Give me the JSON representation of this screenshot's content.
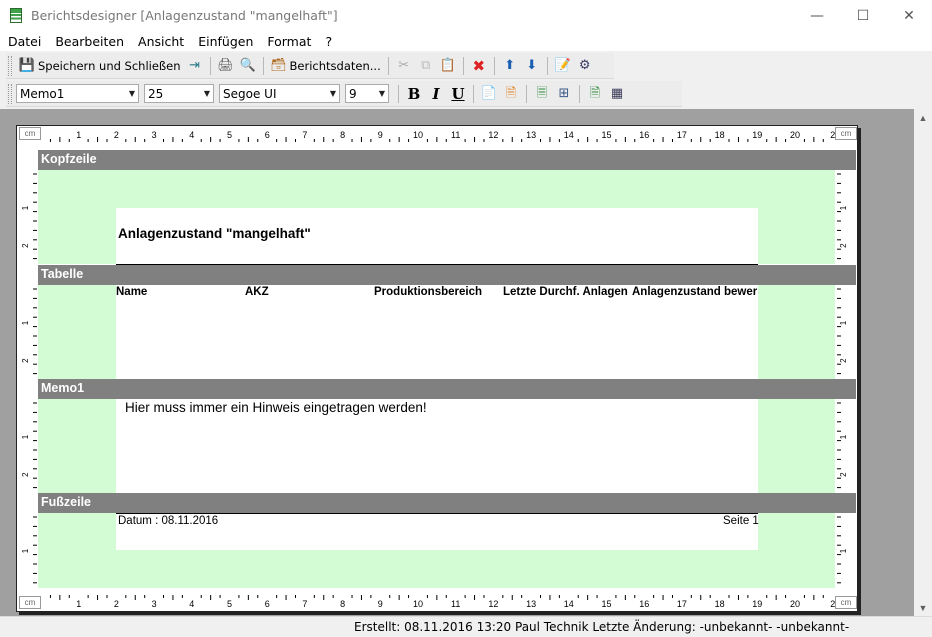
{
  "window": {
    "title": "Berichtsdesigner [Anlagenzustand \"mangelhaft\"]",
    "minimize": "—",
    "maximize": "☐",
    "close": "✕"
  },
  "menu": [
    "Datei",
    "Bearbeiten",
    "Ansicht",
    "Einfügen",
    "Format",
    "?"
  ],
  "toolbar1": {
    "save_close_label": "Speichern und Schließen",
    "report_data_label": "Berichtsdaten..."
  },
  "toolbar2": {
    "element_combo": "Memo1",
    "size_combo": "25",
    "font_combo": "Segoe UI",
    "fontsize_combo": "9",
    "bold": "B",
    "italic": "I",
    "underline": "U"
  },
  "ruler": {
    "unit": "cm",
    "h_ticks": [
      "1",
      "2",
      "3",
      "4",
      "5",
      "6",
      "7",
      "8",
      "9",
      "10",
      "11",
      "12",
      "13",
      "14",
      "15",
      "16",
      "17",
      "18",
      "19",
      "20",
      "2"
    ],
    "v_ticks": [
      "1",
      "2"
    ]
  },
  "report": {
    "bands": [
      {
        "name": "Kopfzeile"
      },
      {
        "name": "Tabelle"
      },
      {
        "name": "Memo1"
      },
      {
        "name": "Fußzeile"
      }
    ],
    "header_title": "Anlagenzustand \"mangelhaft\"",
    "table_columns": [
      "Name",
      "AKZ",
      "Produktionsbereich",
      "Letzte Durchf. Anlagen",
      "Anlagenzustand bewer"
    ],
    "memo_text": "Hier muss immer ein Hinweis eingetragen werden!",
    "footer_left": "Datum : 08.11.2016",
    "footer_right": "Seite 1"
  },
  "status": {
    "text": "Erstellt: 08.11.2016 13:20 Paul Technik  Letzte Änderung: -unbekannt- -unbekannt-"
  },
  "colors": {
    "band_header": "#808080",
    "band_body": "#d4fcd4",
    "canvas": "#a0a0a0"
  }
}
